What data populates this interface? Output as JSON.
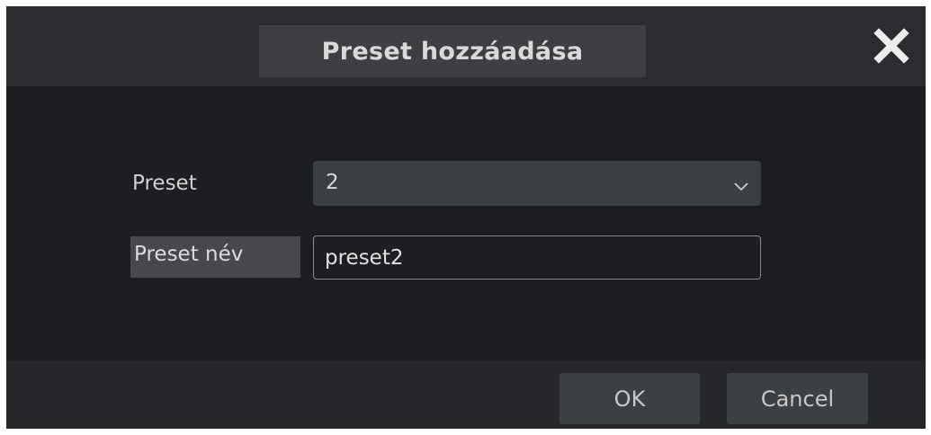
{
  "dialog": {
    "title": "Preset hozzáadása",
    "close_icon": "close-icon"
  },
  "form": {
    "preset_label": "Preset",
    "preset_value": "2",
    "preset_name_label": "Preset név",
    "preset_name_value": "preset2"
  },
  "footer": {
    "ok_label": "OK",
    "cancel_label": "Cancel"
  },
  "colors": {
    "dialog_bg": "#1d1e21",
    "titlebar_bg": "#2b2c2f",
    "title_tab_bg": "#3e3f42",
    "select_bg": "#3b3e42",
    "button_bg": "#3d4043",
    "footer_bg": "#26272a"
  }
}
